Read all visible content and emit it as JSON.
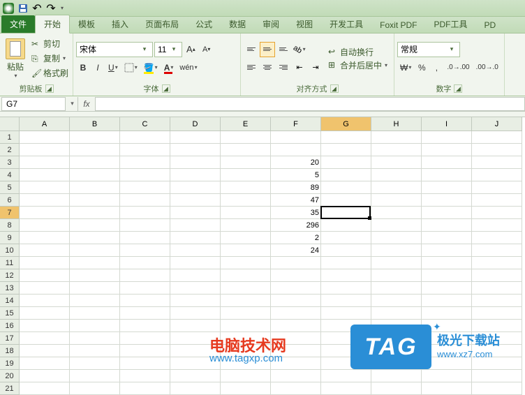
{
  "qat": {
    "save": "💾",
    "undo": "↶",
    "redo": "↷"
  },
  "tabs": {
    "file": "文件",
    "items": [
      "开始",
      "模板",
      "插入",
      "页面布局",
      "公式",
      "数据",
      "审阅",
      "视图",
      "开发工具",
      "Foxit PDF",
      "PDF工具",
      "PD"
    ],
    "active_index": 0
  },
  "ribbon": {
    "clipboard": {
      "paste": "粘贴",
      "cut": "剪切",
      "copy": "复制",
      "format_painter": "格式刷",
      "label": "剪贴板"
    },
    "font": {
      "name": "宋体",
      "size": "11",
      "grow": "A",
      "shrink": "A",
      "bold": "B",
      "italic": "I",
      "underline": "U",
      "label": "字体"
    },
    "align": {
      "wrap": "自动换行",
      "merge": "合并后居中",
      "label": "对齐方式"
    },
    "number": {
      "format": "常规",
      "percent": "%",
      "comma": ",",
      "label": "数字"
    }
  },
  "formula_bar": {
    "name_box": "G7",
    "fx": "fx",
    "value": ""
  },
  "grid": {
    "columns": [
      "A",
      "B",
      "C",
      "D",
      "E",
      "F",
      "G",
      "H",
      "I",
      "J"
    ],
    "rows": 21,
    "active": {
      "col": "G",
      "row": 7
    },
    "data": {
      "F3": "20",
      "F4": "5",
      "F5": "89",
      "F6": "47",
      "F7": "35",
      "F8": "296",
      "F9": "2",
      "F10": "24"
    }
  },
  "watermark": {
    "site1_name": "电脑技术网",
    "site1_url": "www.tagxp.com",
    "tag": "TAG",
    "site2_name": "极光下载站",
    "site2_url": "www.xz7.com"
  }
}
